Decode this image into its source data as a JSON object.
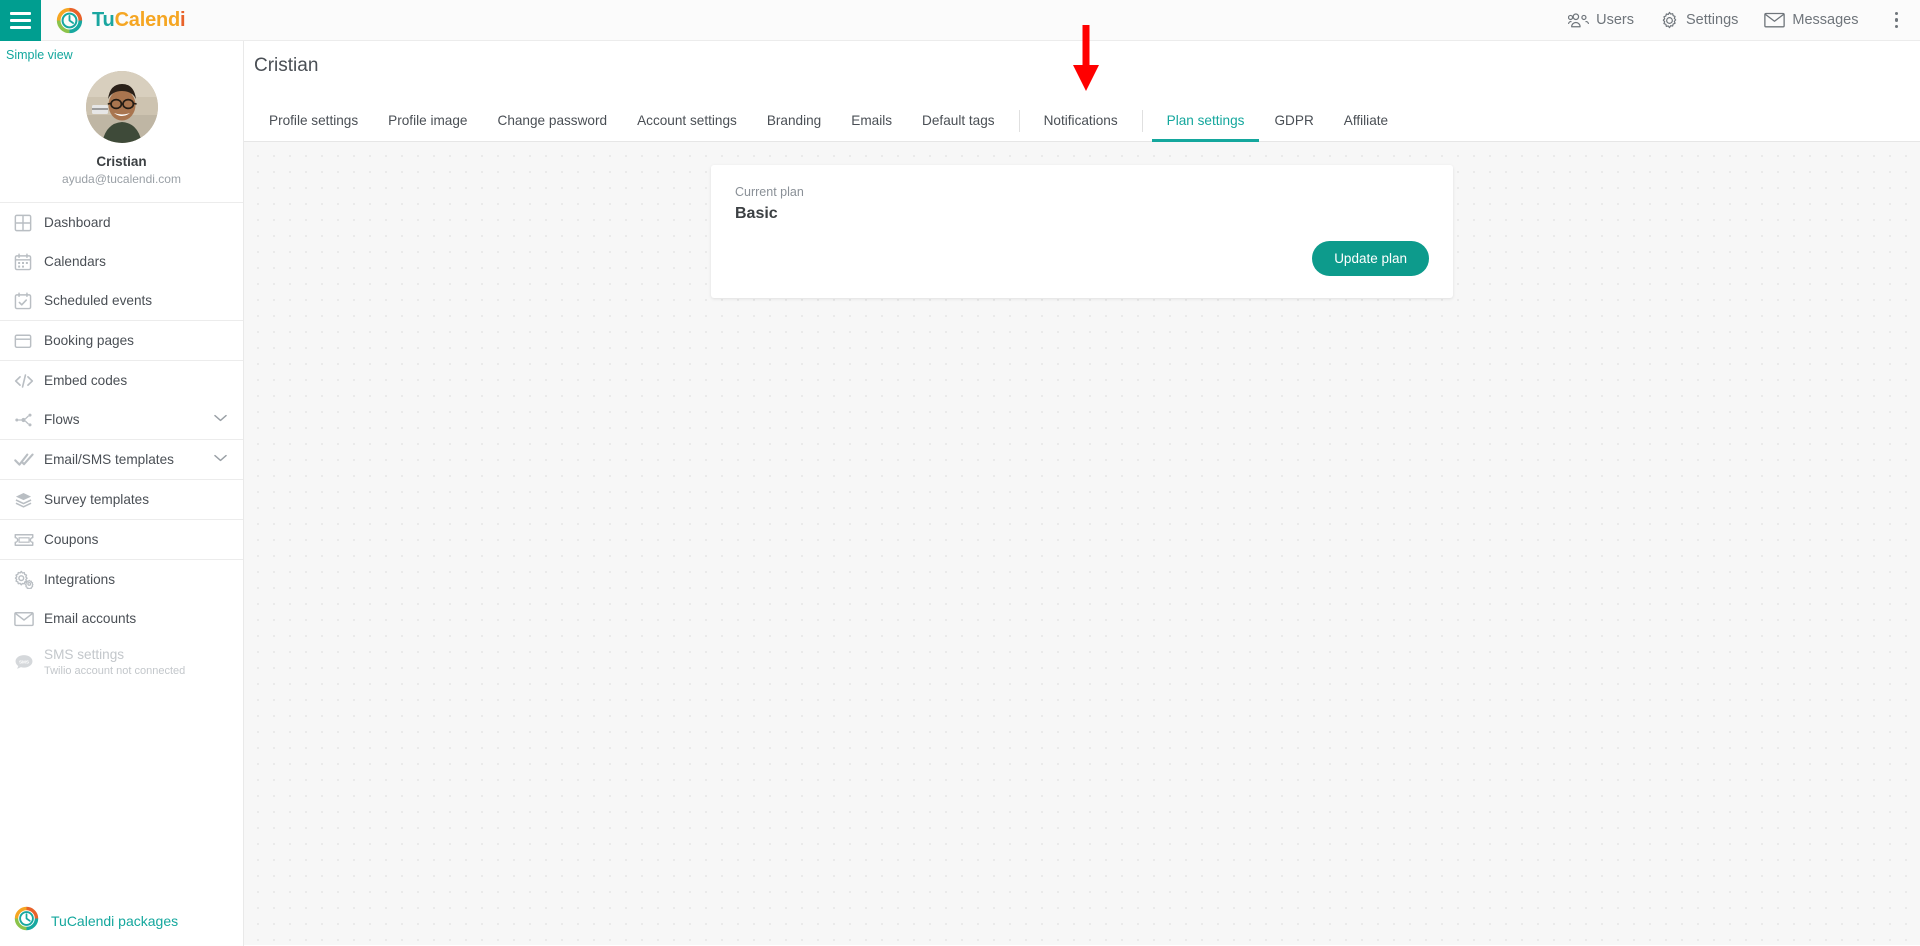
{
  "topbar": {
    "menu_icon": "hamburger-icon",
    "brand": {
      "part1": "Tu",
      "part2": "Calend",
      "part3": "i",
      "logo_icon": "tucalendi-clock-logo"
    },
    "items": [
      {
        "label": "Users",
        "icon": "users-icon"
      },
      {
        "label": "Settings",
        "icon": "gear-icon"
      },
      {
        "label": "Messages",
        "icon": "envelope-icon"
      }
    ],
    "overflow_icon": "kebab-menu-icon"
  },
  "sidebar": {
    "simple_view": "Simple view",
    "profile": {
      "name": "Cristian",
      "email": "ayuda@tucalendi.com",
      "avatar_icon": "user-avatar-photo"
    },
    "groups": [
      {
        "items": [
          {
            "label": "Dashboard",
            "icon": "grid-icon"
          },
          {
            "label": "Calendars",
            "icon": "calendar-icon"
          },
          {
            "label": "Scheduled events",
            "icon": "calendar-check-icon"
          }
        ]
      },
      {
        "items": [
          {
            "label": "Booking pages",
            "icon": "window-icon"
          }
        ]
      },
      {
        "items": [
          {
            "label": "Embed codes",
            "icon": "code-icon"
          },
          {
            "label": "Flows",
            "icon": "flow-nodes-icon",
            "chevron": "⌄"
          }
        ]
      },
      {
        "items": [
          {
            "label": "Email/SMS templates",
            "icon": "double-check-icon",
            "chevron": "⌄"
          }
        ]
      },
      {
        "items": [
          {
            "label": "Survey templates",
            "icon": "layers-icon"
          }
        ]
      },
      {
        "items": [
          {
            "label": "Coupons",
            "icon": "ticket-icon"
          }
        ]
      },
      {
        "items": [
          {
            "label": "Integrations",
            "icon": "gears-icon"
          },
          {
            "label": "Email accounts",
            "icon": "envelope-icon"
          },
          {
            "label": "SMS settings",
            "sublabel": "Twilio account not connected",
            "icon": "sms-bubble-icon",
            "disabled": true
          }
        ]
      }
    ],
    "footer": {
      "label": "TuCalendi packages",
      "icon": "tucalendi-clock-logo"
    }
  },
  "main": {
    "page_title": "Cristian",
    "tabs_left": [
      {
        "label": "Profile settings"
      },
      {
        "label": "Profile image"
      },
      {
        "label": "Change password"
      },
      {
        "label": "Account settings"
      },
      {
        "label": "Branding"
      },
      {
        "label": "Emails"
      },
      {
        "label": "Default tags"
      }
    ],
    "tabs_mid": [
      {
        "label": "Notifications"
      }
    ],
    "tabs_right": [
      {
        "label": "Plan settings",
        "active": true
      },
      {
        "label": "GDPR"
      },
      {
        "label": "Affiliate"
      }
    ],
    "card": {
      "label": "Current plan",
      "value": "Basic",
      "button": "Update plan"
    }
  },
  "annotation": {
    "arrow_icon": "red-down-arrow",
    "color": "#FF0000",
    "points_at": "Plan settings"
  },
  "colors": {
    "accent_teal": "#14a79d",
    "button_teal": "#0d9b8c",
    "menu_teal": "#009e90",
    "brand_orange": "#f5a623",
    "brand_red": "#e8622a",
    "annotation_red": "#FF0000",
    "content_bg": "#f7f7f7"
  }
}
